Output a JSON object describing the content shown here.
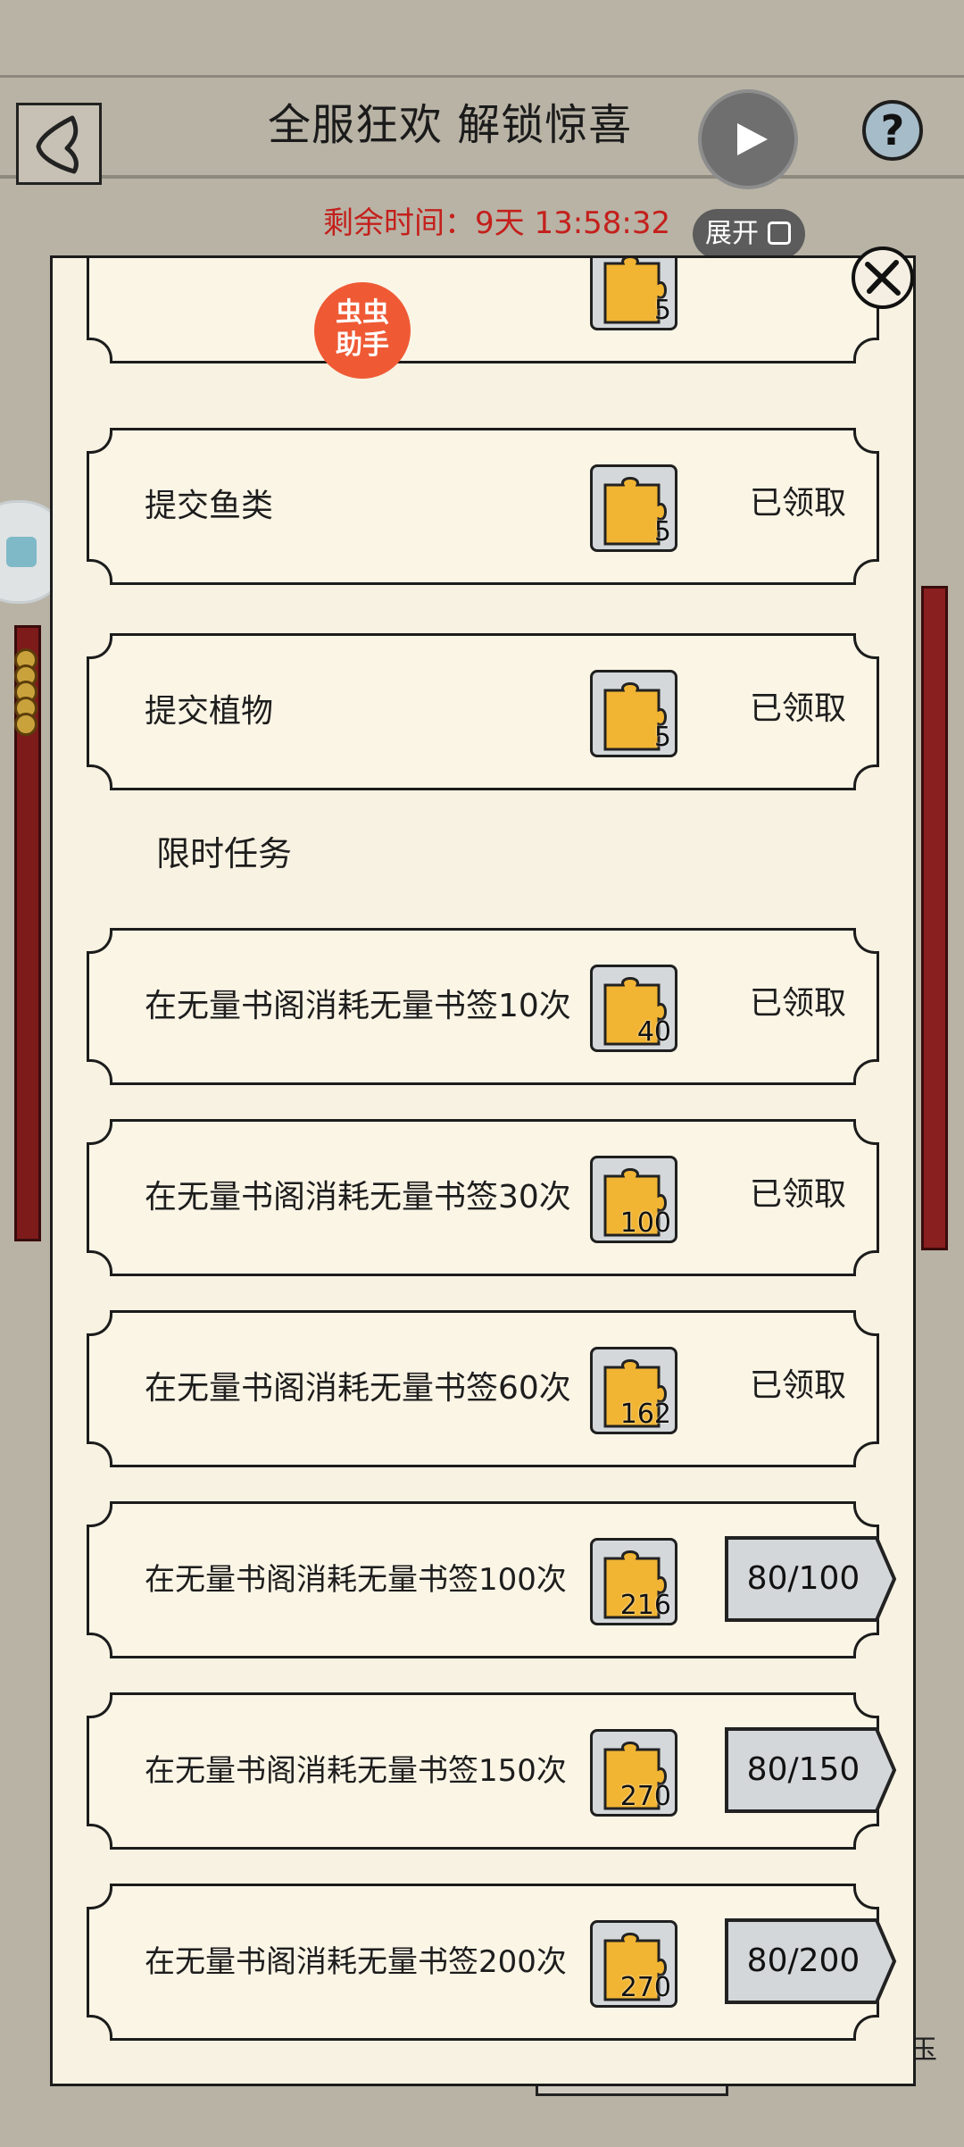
{
  "header": {
    "title": "全服狂欢 解锁惊喜",
    "timer_text": "剩余时间：9天 13:58:32",
    "expand_label": "展开"
  },
  "badge": {
    "line1": "虫虫",
    "line2": "助手"
  },
  "right_edge_char": "玉",
  "section_label": "限时任务",
  "tasks": [
    {
      "label": "提交鱼类",
      "reward": "5",
      "status": "已领取"
    },
    {
      "label": "提交植物",
      "reward": "5",
      "status": "已领取"
    },
    {
      "label": "在无量书阁消耗无量书签10次",
      "reward": "40",
      "status": "已领取"
    },
    {
      "label": "在无量书阁消耗无量书签30次",
      "reward": "100",
      "status": "已领取"
    },
    {
      "label": "在无量书阁消耗无量书签60次",
      "reward": "162",
      "status": "已领取"
    },
    {
      "label": "在无量书阁消耗无量书签100次",
      "reward": "216",
      "progress": "80/100"
    },
    {
      "label": "在无量书阁消耗无量书签150次",
      "reward": "270",
      "progress": "80/150"
    },
    {
      "label": "在无量书阁消耗无量书签200次",
      "reward": "270",
      "progress": "80/200"
    }
  ],
  "partial_top_task": {
    "reward": "5"
  },
  "colors": {
    "accent_red": "#c4201c",
    "panel": "#f8f2e2",
    "puzzle": "#f2b533",
    "badge": "#ef5a35"
  }
}
